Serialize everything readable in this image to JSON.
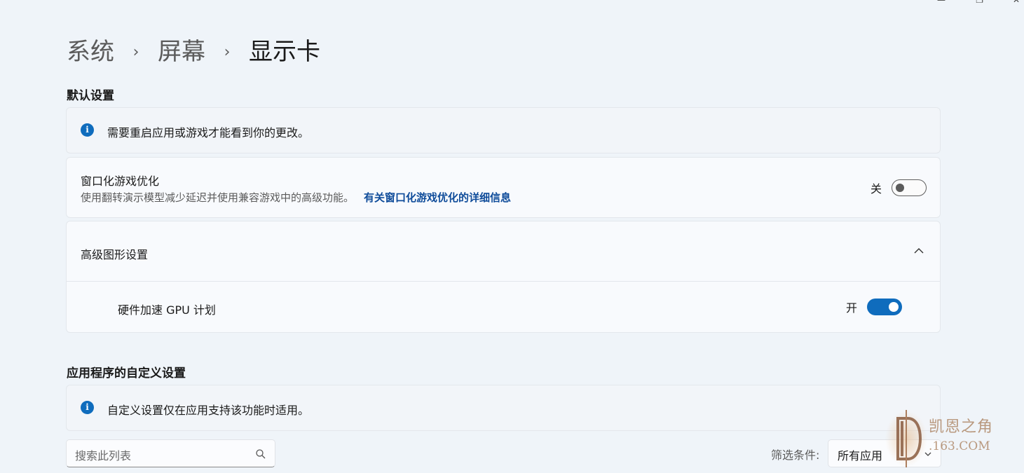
{
  "breadcrumb": {
    "items": [
      "系统",
      "屏幕",
      "显示卡"
    ],
    "separator": "›"
  },
  "default_section": {
    "title": "默认设置",
    "info_text": "需要重启应用或游戏才能看到你的更改。",
    "windowed_opt": {
      "title": "窗口化游戏优化",
      "description": "使用翻转演示模型减少延迟并使用兼容游戏中的高级功能。",
      "link": "有关窗口化游戏优化的详细信息",
      "state_label": "关",
      "enabled": false
    },
    "advanced": {
      "title": "高级图形设置",
      "hags": {
        "title": "硬件加速 GPU 计划",
        "state_label": "开",
        "enabled": true
      }
    }
  },
  "app_section": {
    "title": "应用程序的自定义设置",
    "info_text": "自定义设置仅在应用支持该功能时适用。",
    "search_placeholder": "搜索此列表",
    "filter_label": "筛选条件:",
    "filter_value": "所有应用"
  },
  "watermark": {
    "line1": "凯恩之角",
    "line2": ".163.COM"
  },
  "colors": {
    "accent": "#0f6cbd",
    "link": "#0f4c9a",
    "background": "#eff4f9"
  }
}
